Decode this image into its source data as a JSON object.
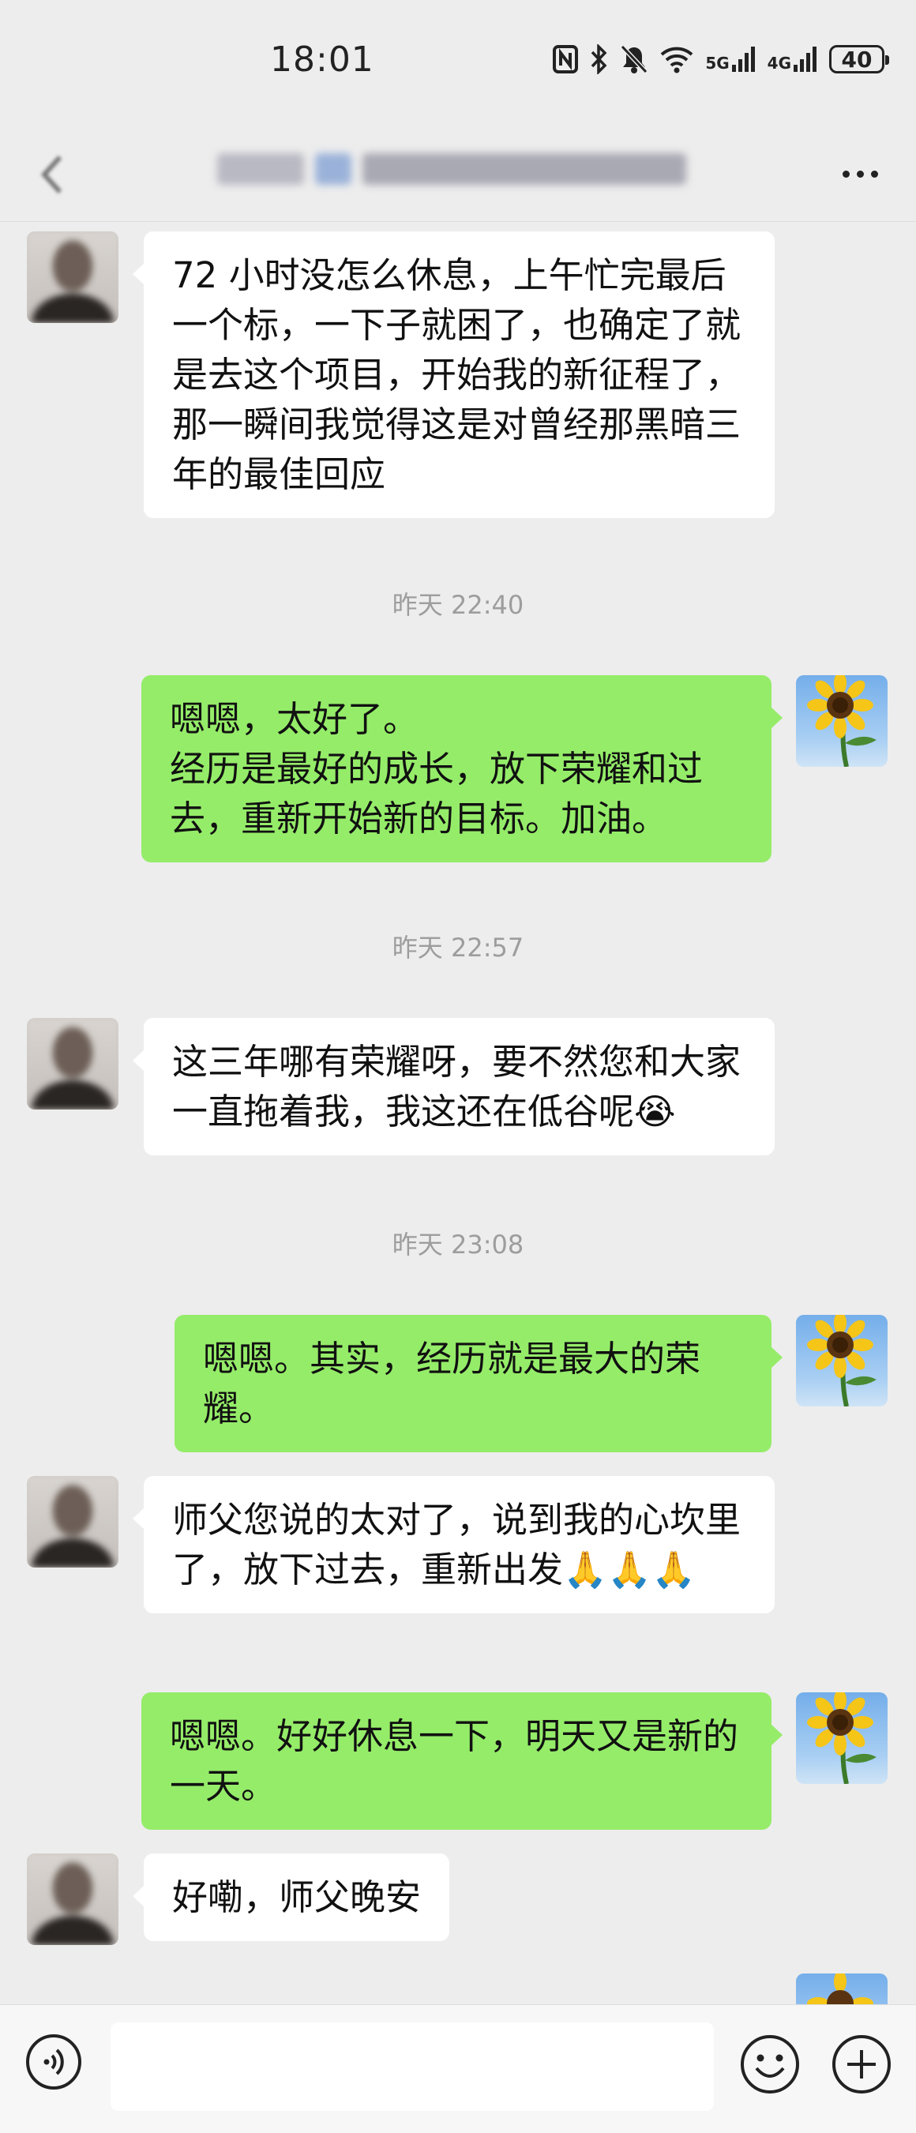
{
  "status_bar": {
    "time": "18:01",
    "network_1": "5G",
    "network_2": "4G",
    "battery": "40"
  },
  "chat": {
    "messages": [
      {
        "sender": "contact",
        "text": "72 小时没怎么休息，上午忙完最后一个标，一下子就困了，也确定了就是去这个项目，开始我的新征程了，那一瞬间我觉得这是对曾经那黑暗三年的最佳回应"
      },
      {
        "sender": "time",
        "text": "昨天 22:40"
      },
      {
        "sender": "me",
        "text": "嗯嗯，太好了。\n经历是最好的成长，放下荣耀和过去，重新开始新的目标。加油。"
      },
      {
        "sender": "time",
        "text": "昨天 22:57"
      },
      {
        "sender": "contact",
        "text": "这三年哪有荣耀呀，要不然您和大家一直拖着我，我这还在低谷呢😭"
      },
      {
        "sender": "time",
        "text": "昨天 23:08"
      },
      {
        "sender": "me",
        "text": "嗯嗯。其实，经历就是最大的荣耀。"
      },
      {
        "sender": "contact",
        "text": "师父您说的太对了，说到我的心坎里了，放下过去，重新出发🙏🙏🙏"
      },
      {
        "sender": "me",
        "text": "嗯嗯。好好休息一下，明天又是新的一天。"
      },
      {
        "sender": "contact",
        "text": "好嘞，师父晚安"
      }
    ]
  },
  "icons": {
    "back": "chevron-left-icon",
    "more": "more-dots-icon",
    "voice": "voice-icon",
    "emoji": "emoji-icon",
    "plus": "plus-icon"
  },
  "colors": {
    "background": "#ededed",
    "my_bubble": "#95ec69",
    "contact_bubble": "#ffffff",
    "timestamp": "#9d9d9d"
  }
}
